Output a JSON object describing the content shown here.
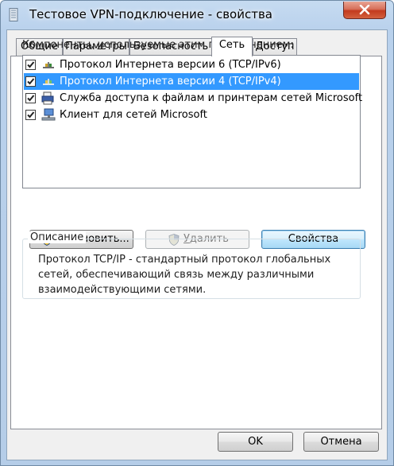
{
  "window": {
    "title": "Тестовое VPN-подключение - свойства"
  },
  "tabs": [
    {
      "label": "Общие",
      "active": false
    },
    {
      "label": "Параметры",
      "active": false
    },
    {
      "label": "Безопасность",
      "active": false
    },
    {
      "label": "Сеть",
      "active": true
    },
    {
      "label": "Доступ",
      "active": false
    }
  ],
  "components": {
    "label_prefix": "Компоненты, ",
    "label_underlined": "и",
    "label_suffix": "спользуемые этим подключением:",
    "items": [
      {
        "label": "Протокол Интернета версии 6 (TCP/IPv6)",
        "checked": true,
        "selected": false,
        "icon": "network-protocol-icon"
      },
      {
        "label": "Протокол Интернета версии 4 (TCP/IPv4)",
        "checked": true,
        "selected": true,
        "icon": "network-protocol-icon"
      },
      {
        "label": "Служба доступа к файлам и принтерам сетей Microsoft",
        "checked": true,
        "selected": false,
        "icon": "printer-service-icon"
      },
      {
        "label": "Клиент для сетей Microsoft",
        "checked": true,
        "selected": false,
        "icon": "network-client-icon"
      }
    ]
  },
  "buttons": {
    "install": {
      "underlined": "У",
      "rest": "становить...",
      "enabled": true
    },
    "remove": {
      "underlined": "У",
      "rest": "далить",
      "enabled": false
    },
    "properties": {
      "label": "Свойства",
      "enabled": true
    }
  },
  "description": {
    "title": "Описание",
    "lines": [
      "Протокол TCP/IP - стандартный протокол глобальных",
      "сетей, обеспечивающий связь между различными",
      "взаимодействующими сетями."
    ]
  },
  "footer": {
    "ok": "OK",
    "cancel": "Отмена"
  },
  "colors": {
    "selection": "#3399ff",
    "close_button": "#c23a1e",
    "title_bar": "#b9d1ec"
  }
}
